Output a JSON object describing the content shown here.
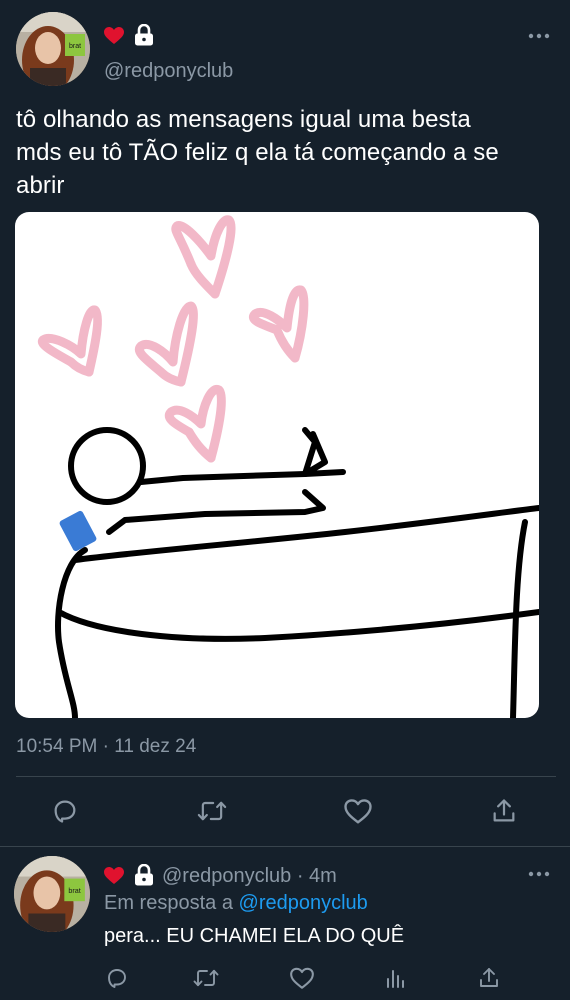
{
  "main_tweet": {
    "handle": "@redponyclub",
    "text_lines": [
      "tô olhando as mensagens igual uma besta",
      "mds eu tô TÃO feliz q ela tá começando a se",
      "abrir"
    ],
    "timestamp": "10:54 PM · 11 dez 24",
    "avatar_sign_text": "brat",
    "icons": [
      "heart-emoji",
      "lock-icon",
      "more-icon",
      "reply-icon",
      "retweet-icon",
      "like-icon",
      "share-icon"
    ]
  },
  "reply_tweet": {
    "handle": "@redponyclub",
    "time": "· 4m",
    "reply_prefix": "Em resposta a",
    "reply_to": "@redponyclub",
    "text": "pera... EU CHAMEI ELA DO QUÊ",
    "avatar_sign_text": "brat",
    "icons": [
      "heart-emoji",
      "lock-icon",
      "more-icon",
      "reply-icon",
      "retweet-icon",
      "like-icon",
      "analytics-icon",
      "share-icon"
    ]
  },
  "colors": {
    "background": "#15202b",
    "text": "#ffffff",
    "muted": "#8b98a5",
    "link": "#1d9bf0",
    "divider": "#38444d"
  }
}
